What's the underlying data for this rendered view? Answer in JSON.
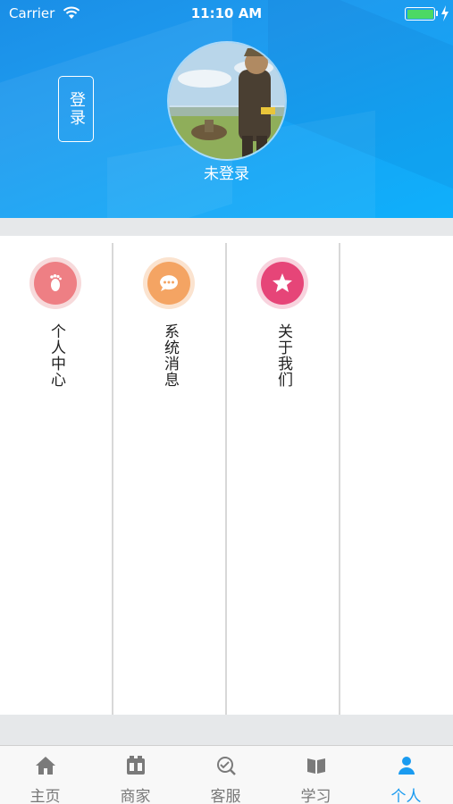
{
  "status_bar": {
    "carrier": "Carrier",
    "time": "11:10 AM"
  },
  "header": {
    "login_label": "登录",
    "user_name": "未登录"
  },
  "menu": {
    "items": [
      {
        "label": "个人中心",
        "icon": "footprint-icon",
        "color": "#ee7f84"
      },
      {
        "label": "系统消息",
        "icon": "chat-bubble-icon",
        "color": "#f4a463"
      },
      {
        "label": "关于我们",
        "icon": "star-icon",
        "color": "#e64578"
      }
    ]
  },
  "tabbar": {
    "active": "个人",
    "items": [
      {
        "label": "主页",
        "icon": "home-icon"
      },
      {
        "label": "商家",
        "icon": "shop-icon"
      },
      {
        "label": "客服",
        "icon": "service-icon"
      },
      {
        "label": "学习",
        "icon": "book-icon"
      },
      {
        "label": "个人",
        "icon": "person-icon"
      }
    ]
  },
  "colors": {
    "accent": "#1a9bf0",
    "header_bg": "#1e9bef"
  }
}
